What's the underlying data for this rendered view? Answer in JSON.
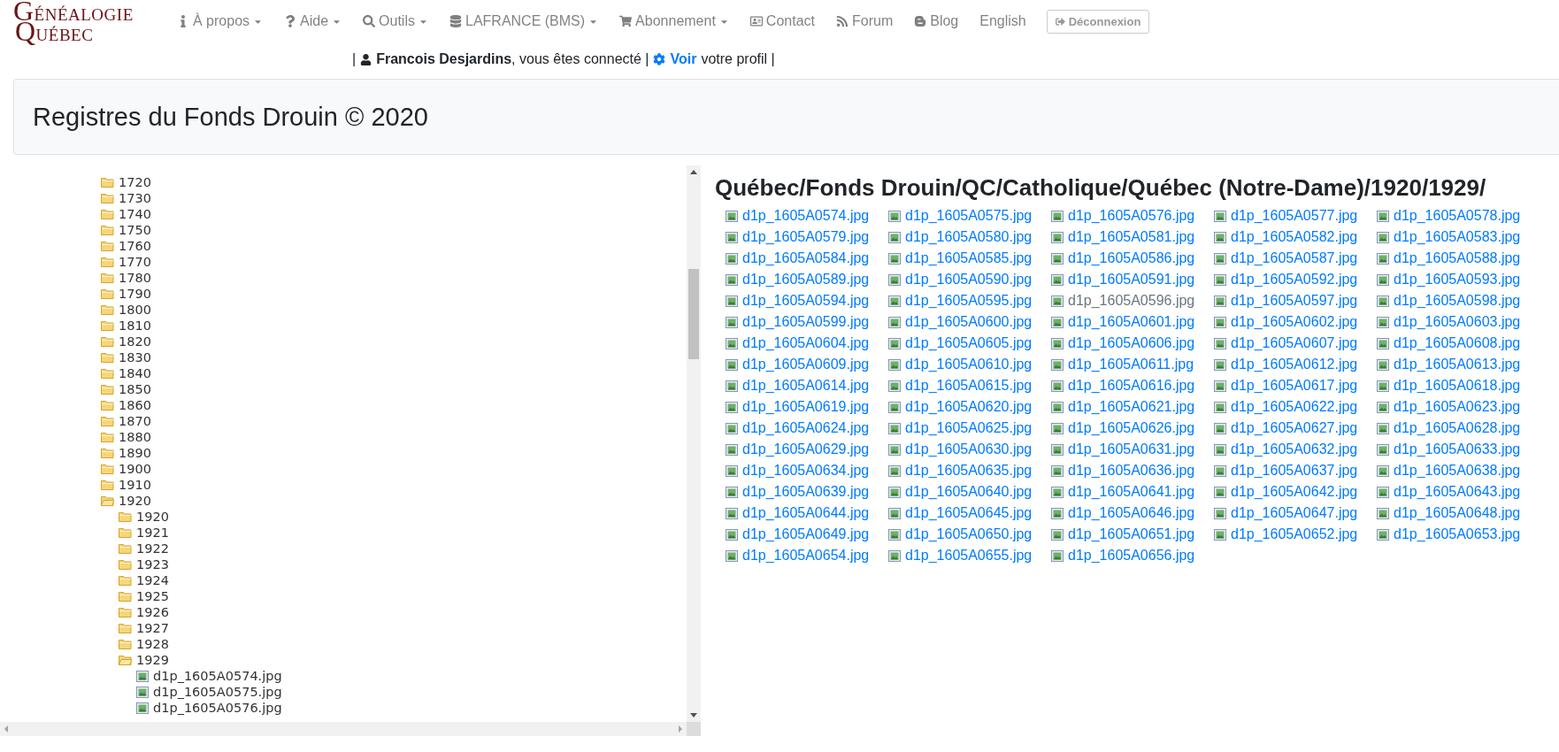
{
  "logo": {
    "line_1": "GÉNÉALOGIE",
    "line_2": "QUÉBEC"
  },
  "nav": [
    {
      "label": "À propos",
      "kind": "dropdown"
    },
    {
      "label": "Aide",
      "kind": "dropdown"
    },
    {
      "label": "Outils",
      "kind": "dropdown"
    },
    {
      "label": "LAFRANCE (BMS)",
      "kind": "dropdown"
    },
    {
      "label": "Abonnement",
      "kind": "dropdown"
    },
    {
      "label": "Contact",
      "kind": "link"
    },
    {
      "label": "Forum",
      "kind": "link"
    },
    {
      "label": "Blog",
      "kind": "link"
    },
    {
      "label": "English",
      "kind": "link"
    },
    {
      "label": "Déconnexion",
      "kind": "button"
    }
  ],
  "user_bar": {
    "lead": "|",
    "user": "Francois Desjardins",
    "status": ", vous êtes connecté |",
    "link": "Voir",
    "tail": "votre profil |"
  },
  "page_title": "Registres du Fonds Drouin © 2020",
  "tree": [
    {
      "label": "1720",
      "kind": "folder",
      "expanded": false
    },
    {
      "label": "1730",
      "kind": "folder",
      "expanded": false
    },
    {
      "label": "1740",
      "kind": "folder",
      "expanded": false
    },
    {
      "label": "1750",
      "kind": "folder",
      "expanded": false
    },
    {
      "label": "1760",
      "kind": "folder",
      "expanded": false
    },
    {
      "label": "1770",
      "kind": "folder",
      "expanded": false
    },
    {
      "label": "1780",
      "kind": "folder",
      "expanded": false
    },
    {
      "label": "1790",
      "kind": "folder",
      "expanded": false
    },
    {
      "label": "1800",
      "kind": "folder",
      "expanded": false
    },
    {
      "label": "1810",
      "kind": "folder",
      "expanded": false
    },
    {
      "label": "1820",
      "kind": "folder",
      "expanded": false
    },
    {
      "label": "1830",
      "kind": "folder",
      "expanded": false
    },
    {
      "label": "1840",
      "kind": "folder",
      "expanded": false
    },
    {
      "label": "1850",
      "kind": "folder",
      "expanded": false
    },
    {
      "label": "1860",
      "kind": "folder",
      "expanded": false
    },
    {
      "label": "1870",
      "kind": "folder",
      "expanded": false
    },
    {
      "label": "1880",
      "kind": "folder",
      "expanded": false
    },
    {
      "label": "1890",
      "kind": "folder",
      "expanded": false
    },
    {
      "label": "1900",
      "kind": "folder",
      "expanded": false
    },
    {
      "label": "1910",
      "kind": "folder",
      "expanded": false
    },
    {
      "label": "1920",
      "kind": "folder",
      "expanded": true,
      "children": [
        {
          "label": "1920",
          "kind": "folder",
          "expanded": false
        },
        {
          "label": "1921",
          "kind": "folder",
          "expanded": false
        },
        {
          "label": "1922",
          "kind": "folder",
          "expanded": false
        },
        {
          "label": "1923",
          "kind": "folder",
          "expanded": false
        },
        {
          "label": "1924",
          "kind": "folder",
          "expanded": false
        },
        {
          "label": "1925",
          "kind": "folder",
          "expanded": false
        },
        {
          "label": "1926",
          "kind": "folder",
          "expanded": false
        },
        {
          "label": "1927",
          "kind": "folder",
          "expanded": false
        },
        {
          "label": "1928",
          "kind": "folder",
          "expanded": false
        },
        {
          "label": "1929",
          "kind": "folder",
          "expanded": true,
          "children": [
            {
              "label": "d1p_1605A0574.jpg",
              "kind": "file"
            },
            {
              "label": "d1p_1605A0575.jpg",
              "kind": "file"
            },
            {
              "label": "d1p_1605A0576.jpg",
              "kind": "file"
            }
          ]
        }
      ]
    }
  ],
  "path_title": "Québec/Fonds Drouin/QC/Catholique/Québec (Notre-Dame)/1920/1929/",
  "files": [
    {
      "name": "d1p_1605A0574.jpg",
      "visited": false
    },
    {
      "name": "d1p_1605A0575.jpg",
      "visited": false
    },
    {
      "name": "d1p_1605A0576.jpg",
      "visited": false
    },
    {
      "name": "d1p_1605A0577.jpg",
      "visited": false
    },
    {
      "name": "d1p_1605A0578.jpg",
      "visited": false
    },
    {
      "name": "d1p_1605A0579.jpg",
      "visited": false
    },
    {
      "name": "d1p_1605A0580.jpg",
      "visited": false
    },
    {
      "name": "d1p_1605A0581.jpg",
      "visited": false
    },
    {
      "name": "d1p_1605A0582.jpg",
      "visited": false
    },
    {
      "name": "d1p_1605A0583.jpg",
      "visited": false
    },
    {
      "name": "d1p_1605A0584.jpg",
      "visited": false
    },
    {
      "name": "d1p_1605A0585.jpg",
      "visited": false
    },
    {
      "name": "d1p_1605A0586.jpg",
      "visited": false
    },
    {
      "name": "d1p_1605A0587.jpg",
      "visited": false
    },
    {
      "name": "d1p_1605A0588.jpg",
      "visited": false
    },
    {
      "name": "d1p_1605A0589.jpg",
      "visited": false
    },
    {
      "name": "d1p_1605A0590.jpg",
      "visited": false
    },
    {
      "name": "d1p_1605A0591.jpg",
      "visited": false
    },
    {
      "name": "d1p_1605A0592.jpg",
      "visited": false
    },
    {
      "name": "d1p_1605A0593.jpg",
      "visited": false
    },
    {
      "name": "d1p_1605A0594.jpg",
      "visited": false
    },
    {
      "name": "d1p_1605A0595.jpg",
      "visited": false
    },
    {
      "name": "d1p_1605A0596.jpg",
      "visited": true
    },
    {
      "name": "d1p_1605A0597.jpg",
      "visited": false
    },
    {
      "name": "d1p_1605A0598.jpg",
      "visited": false
    },
    {
      "name": "d1p_1605A0599.jpg",
      "visited": false
    },
    {
      "name": "d1p_1605A0600.jpg",
      "visited": false
    },
    {
      "name": "d1p_1605A0601.jpg",
      "visited": false
    },
    {
      "name": "d1p_1605A0602.jpg",
      "visited": false
    },
    {
      "name": "d1p_1605A0603.jpg",
      "visited": false
    },
    {
      "name": "d1p_1605A0604.jpg",
      "visited": false
    },
    {
      "name": "d1p_1605A0605.jpg",
      "visited": false
    },
    {
      "name": "d1p_1605A0606.jpg",
      "visited": false
    },
    {
      "name": "d1p_1605A0607.jpg",
      "visited": false
    },
    {
      "name": "d1p_1605A0608.jpg",
      "visited": false
    },
    {
      "name": "d1p_1605A0609.jpg",
      "visited": false
    },
    {
      "name": "d1p_1605A0610.jpg",
      "visited": false
    },
    {
      "name": "d1p_1605A0611.jpg",
      "visited": false
    },
    {
      "name": "d1p_1605A0612.jpg",
      "visited": false
    },
    {
      "name": "d1p_1605A0613.jpg",
      "visited": false
    },
    {
      "name": "d1p_1605A0614.jpg",
      "visited": false
    },
    {
      "name": "d1p_1605A0615.jpg",
      "visited": false
    },
    {
      "name": "d1p_1605A0616.jpg",
      "visited": false
    },
    {
      "name": "d1p_1605A0617.jpg",
      "visited": false
    },
    {
      "name": "d1p_1605A0618.jpg",
      "visited": false
    },
    {
      "name": "d1p_1605A0619.jpg",
      "visited": false
    },
    {
      "name": "d1p_1605A0620.jpg",
      "visited": false
    },
    {
      "name": "d1p_1605A0621.jpg",
      "visited": false
    },
    {
      "name": "d1p_1605A0622.jpg",
      "visited": false
    },
    {
      "name": "d1p_1605A0623.jpg",
      "visited": false
    },
    {
      "name": "d1p_1605A0624.jpg",
      "visited": false
    },
    {
      "name": "d1p_1605A0625.jpg",
      "visited": false
    },
    {
      "name": "d1p_1605A0626.jpg",
      "visited": false
    },
    {
      "name": "d1p_1605A0627.jpg",
      "visited": false
    },
    {
      "name": "d1p_1605A0628.jpg",
      "visited": false
    },
    {
      "name": "d1p_1605A0629.jpg",
      "visited": false
    },
    {
      "name": "d1p_1605A0630.jpg",
      "visited": false
    },
    {
      "name": "d1p_1605A0631.jpg",
      "visited": false
    },
    {
      "name": "d1p_1605A0632.jpg",
      "visited": false
    },
    {
      "name": "d1p_1605A0633.jpg",
      "visited": false
    },
    {
      "name": "d1p_1605A0634.jpg",
      "visited": false
    },
    {
      "name": "d1p_1605A0635.jpg",
      "visited": false
    },
    {
      "name": "d1p_1605A0636.jpg",
      "visited": false
    },
    {
      "name": "d1p_1605A0637.jpg",
      "visited": false
    },
    {
      "name": "d1p_1605A0638.jpg",
      "visited": false
    },
    {
      "name": "d1p_1605A0639.jpg",
      "visited": false
    },
    {
      "name": "d1p_1605A0640.jpg",
      "visited": false
    },
    {
      "name": "d1p_1605A0641.jpg",
      "visited": false
    },
    {
      "name": "d1p_1605A0642.jpg",
      "visited": false
    },
    {
      "name": "d1p_1605A0643.jpg",
      "visited": false
    },
    {
      "name": "d1p_1605A0644.jpg",
      "visited": false
    },
    {
      "name": "d1p_1605A0645.jpg",
      "visited": false
    },
    {
      "name": "d1p_1605A0646.jpg",
      "visited": false
    },
    {
      "name": "d1p_1605A0647.jpg",
      "visited": false
    },
    {
      "name": "d1p_1605A0648.jpg",
      "visited": false
    },
    {
      "name": "d1p_1605A0649.jpg",
      "visited": false
    },
    {
      "name": "d1p_1605A0650.jpg",
      "visited": false
    },
    {
      "name": "d1p_1605A0651.jpg",
      "visited": false
    },
    {
      "name": "d1p_1605A0652.jpg",
      "visited": false
    },
    {
      "name": "d1p_1605A0653.jpg",
      "visited": false
    },
    {
      "name": "d1p_1605A0654.jpg",
      "visited": false
    },
    {
      "name": "d1p_1605A0655.jpg",
      "visited": false
    },
    {
      "name": "d1p_1605A0656.jpg",
      "visited": false
    }
  ]
}
